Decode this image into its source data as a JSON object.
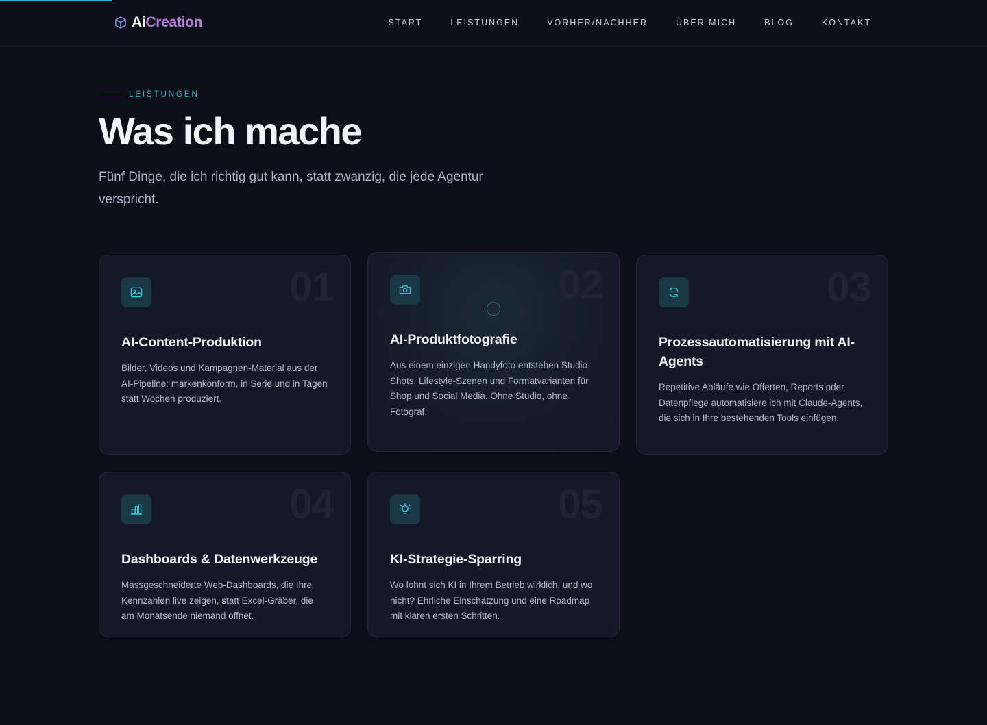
{
  "header": {
    "logo": {
      "part1": "Ai",
      "part2": "Creation",
      "icon": "cube-icon"
    },
    "nav": [
      "START",
      "LEISTUNGEN",
      "VORHER/NACHHER",
      "ÜBER MICH",
      "BLOG",
      "KONTAKT"
    ]
  },
  "hero": {
    "eyebrow": "LEISTUNGEN",
    "title": "Was ich mache",
    "subtitle": "Fünf Dinge, die ich richtig gut kann, statt zwanzig, die jede Agentur verspricht."
  },
  "cards": [
    {
      "number": "01",
      "icon": "image-icon",
      "title": "AI-Content-Produktion",
      "description": "Bilder, Videos und Kampagnen-Material aus der AI-Pipeline: markenkonform, in Serie und in Tagen statt Wochen produziert."
    },
    {
      "number": "02",
      "icon": "camera-icon",
      "title": "AI-Produktfotografie",
      "description": "Aus einem einzigen Handyfoto entstehen Studio-Shots, Lifestyle-Szenen und Formatvarianten für Shop und Social Media. Ohne Studio, ohne Fotograf."
    },
    {
      "number": "03",
      "icon": "refresh-icon",
      "title": "Prozessautomatisierung mit AI-Agents",
      "description": "Repetitive Abläufe wie Offerten, Reports oder Datenpflege automatisiere ich mit Claude-Agents, die sich in Ihre bestehenden Tools einfügen."
    },
    {
      "number": "04",
      "icon": "bar-chart-icon",
      "title": "Dashboards & Datenwerkzeuge",
      "description": "Massgeschneiderte Web-Dashboards, die Ihre Kennzahlen live zeigen, statt Excel-Gräber, die am Monatsende niemand öffnet."
    },
    {
      "number": "05",
      "icon": "lightbulb-icon",
      "title": "KI-Strategie-Sparring",
      "description": "Wo lohnt sich KI in Ihrem Betrieb wirklich, und wo nicht? Ehrliche Einschätzung und eine Roadmap mit klaren ersten Schritten."
    }
  ],
  "colors": {
    "accent": "#22b8c8",
    "brand_gradient_end": "#b37fd9",
    "background": "#0c0e18",
    "card": "#151826"
  }
}
